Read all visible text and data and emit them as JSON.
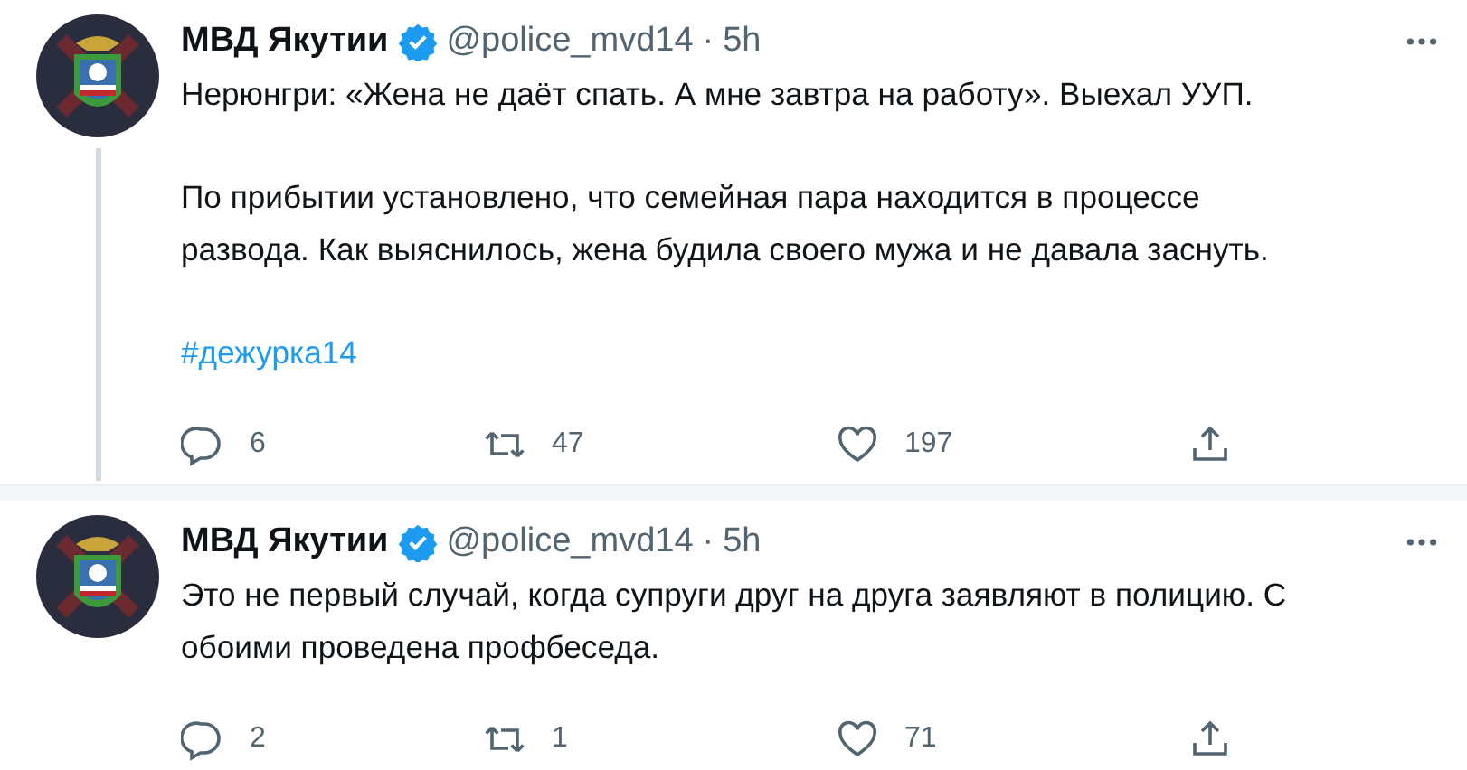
{
  "tweets": [
    {
      "name": "МВД Якутии",
      "verified": true,
      "handle": "@police_mvd14",
      "separator": "·",
      "time": "5h",
      "thread_line": true,
      "paragraphs": [
        "Нерюнгри: «Жена не даёт спать. А мне завтра на работу». Выехал УУП.",
        "По прибытии установлено, что семейная пара находится в процессе развода. Как выяснилось, жена будила своего мужа и не давала заснуть."
      ],
      "hashtag": "#дежурка14",
      "replies": "6",
      "retweets": "47",
      "likes": "197"
    },
    {
      "name": "МВД Якутии",
      "verified": true,
      "handle": "@police_mvd14",
      "separator": "·",
      "time": "5h",
      "thread_line": false,
      "paragraphs": [
        "Это не первый случай, когда супруги друг на друга заявляют в полицию. С обоими проведена профбеседа."
      ],
      "replies": "2",
      "retweets": "1",
      "likes": "71"
    }
  ]
}
